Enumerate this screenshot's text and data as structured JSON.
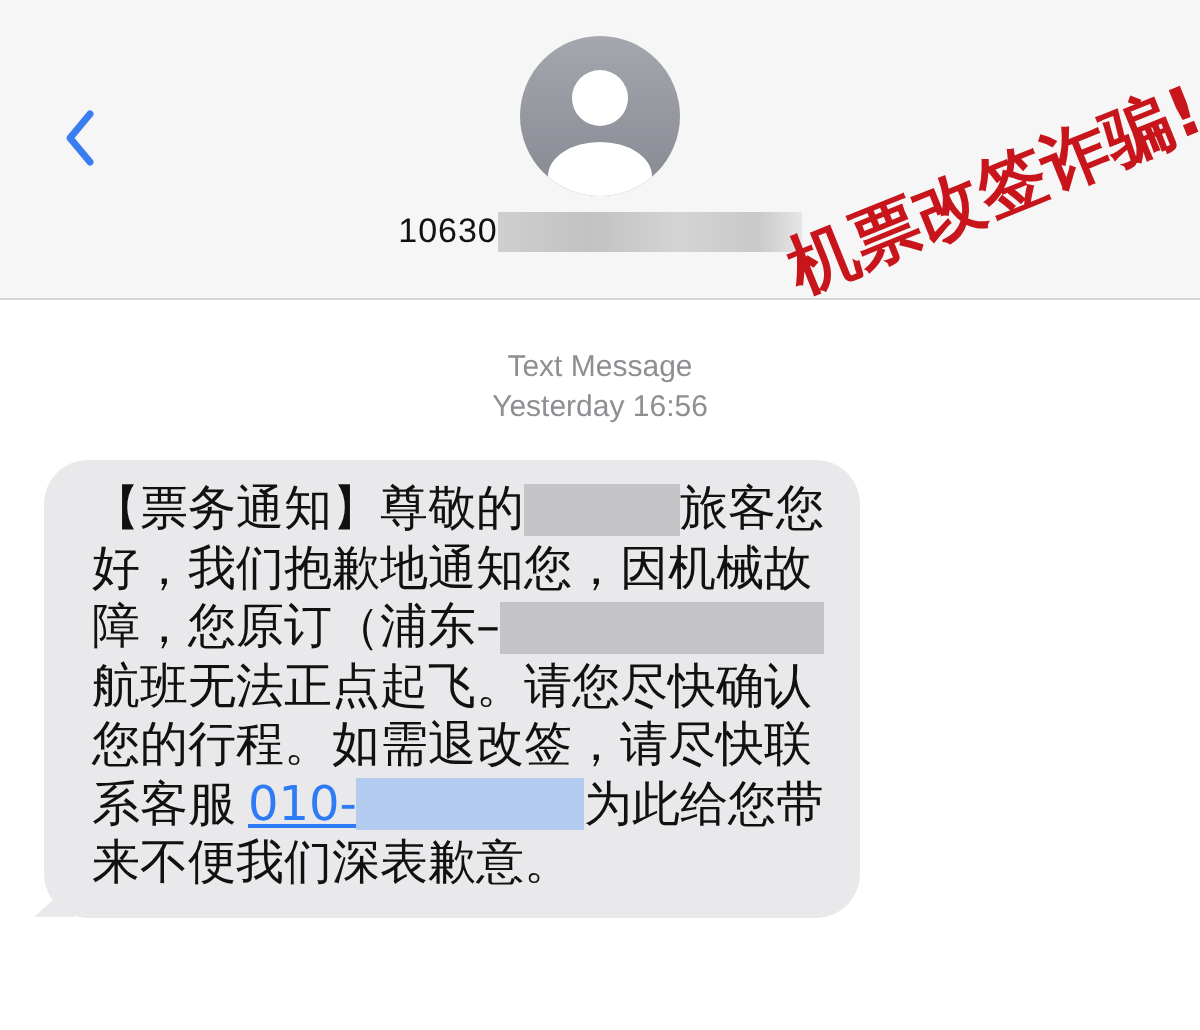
{
  "header": {
    "sender": [
      {
        "kind": "text",
        "text": "10630"
      },
      {
        "kind": "redacted"
      }
    ]
  },
  "timestamp": {
    "label": "Text Message",
    "time": "Yesterday 16:56"
  },
  "message_lines": [
    [
      {
        "kind": "text",
        "text": "【票务通知】尊敬的"
      },
      {
        "kind": "redacted",
        "color": "#c4c4c7"
      },
      {
        "kind": "text",
        "text": "旅客您"
      }
    ],
    [
      {
        "kind": "text",
        "text": "好，我们抱歉地通知您，因机械故"
      }
    ],
    [
      {
        "kind": "text",
        "text": "障，您原订（浦东–"
      },
      {
        "kind": "redacted",
        "color": "#c4c4c7"
      }
    ],
    [
      {
        "kind": "text",
        "text": "航班无法正点起飞。请您尽快确认"
      }
    ],
    [
      {
        "kind": "text",
        "text": "您的行程。如需退改签，请尽快联"
      }
    ],
    [
      {
        "kind": "text",
        "text": "系客服"
      },
      {
        "kind": "link",
        "text": "010-"
      },
      {
        "kind": "redacted",
        "color": "#b4cbf0"
      },
      {
        "kind": "text",
        "text": "为此给您带"
      }
    ],
    [
      {
        "kind": "text",
        "text": "来不便我们深表歉意。"
      }
    ]
  ],
  "stamp": {
    "text": "机票改签诈骗!"
  }
}
